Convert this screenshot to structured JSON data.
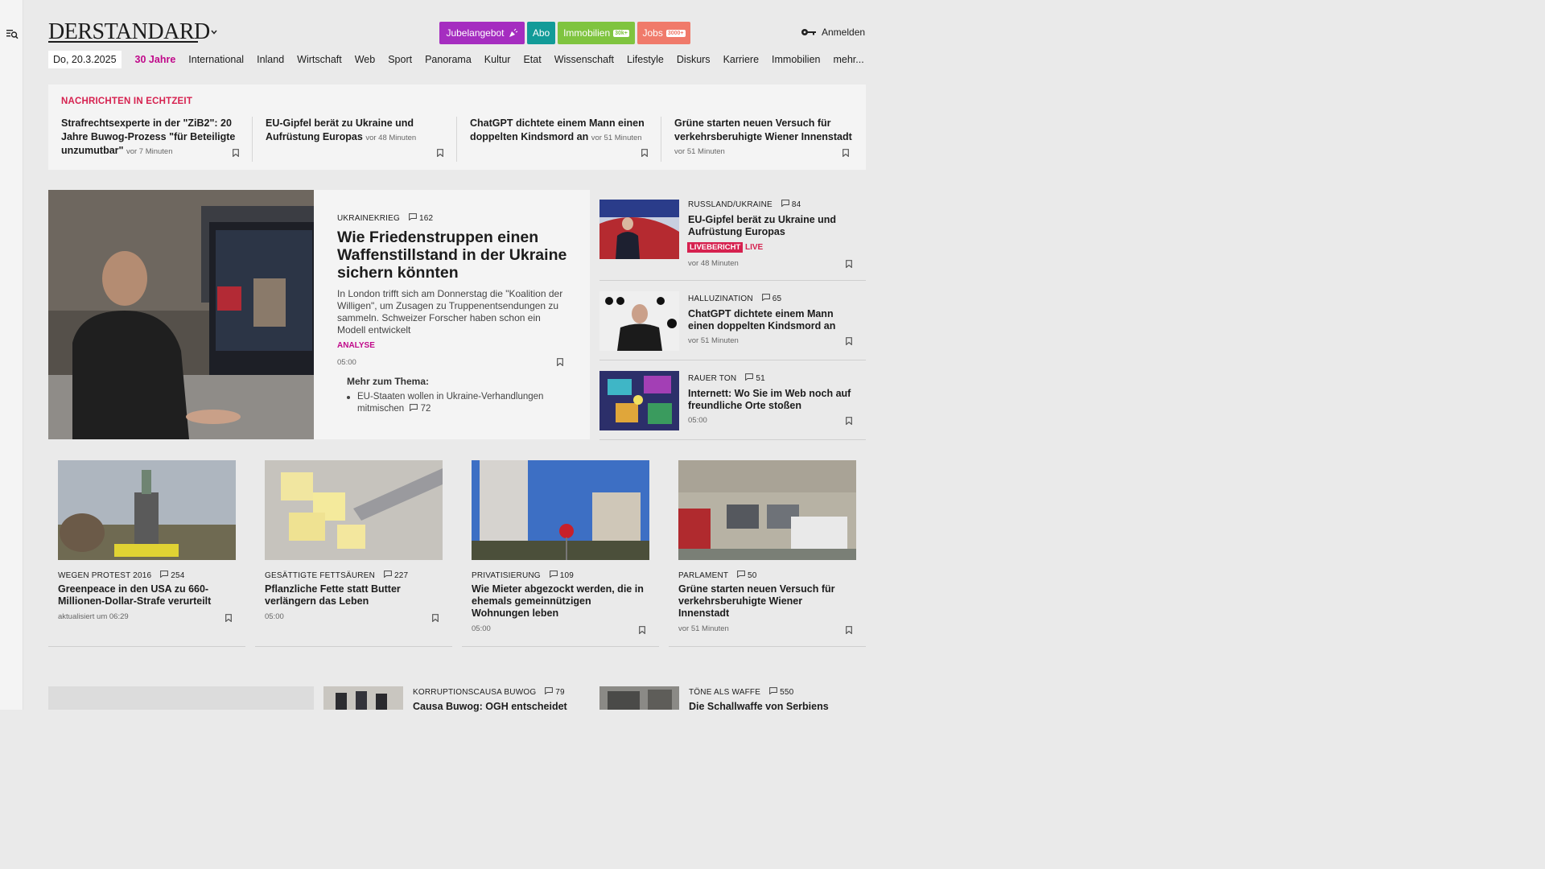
{
  "colors": {
    "magenta": "#c0098a",
    "red": "#d6214f",
    "teal": "#129b98",
    "green": "#7fc43f",
    "salmon": "#f07a6a"
  },
  "logo": {
    "text": "DERSTANDARD"
  },
  "promos": [
    {
      "label": "Jubelangebot",
      "color": "#a52dc0",
      "icon": "confetti-icon"
    },
    {
      "label": "Abo",
      "color": "#129b98"
    },
    {
      "label": "Immobilien",
      "badge": "30k+",
      "color": "#7fc43f"
    },
    {
      "label": "Jobs",
      "badge": "3000+",
      "color": "#f07a6a"
    }
  ],
  "login": {
    "label": "Anmelden",
    "icon": "key-icon"
  },
  "nav": {
    "date": "Do, 20.3.2025",
    "items": [
      "30 Jahre",
      "International",
      "Inland",
      "Wirtschaft",
      "Web",
      "Sport",
      "Panorama",
      "Kultur",
      "Etat",
      "Wissenschaft",
      "Lifestyle",
      "Diskurs",
      "Karriere",
      "Immobilien",
      "mehr..."
    ]
  },
  "ticker": {
    "heading": "NACHRICHTEN IN ECHTZEIT",
    "items": [
      {
        "title": "Strafrechtsexperte in der \"ZiB2\": 20 Jahre Buwog-Prozess \"für Beteiligte unzumutbar\"",
        "time": "vor 7 Minuten"
      },
      {
        "title": "EU-Gipfel berät zu Ukraine und Aufrüstung Europas",
        "time": "vor 48 Minuten"
      },
      {
        "title": "ChatGPT dichtete einem Mann einen doppelten Kindsmord an",
        "time": "vor 51 Minuten"
      },
      {
        "title": "Grüne starten neuen Versuch für verkehrsberuhigte Wiener Innenstadt",
        "time": "vor 51 Minuten"
      }
    ]
  },
  "lead": {
    "kicker": "UKRAINEKRIEG",
    "comments": "162",
    "title": "Wie Friedenstruppen einen Waffenstillstand in der Ukraine sichern könnten",
    "teaser": "In London trifft sich am Donnerstag die \"Koalition der Willigen\", um Zusagen zu Truppenentsendungen zu sammeln. Schweizer Forscher haben schon ein Modell entwickelt",
    "label": "ANALYSE",
    "time": "05:00",
    "more_title": "Mehr zum Thema:",
    "more_item": "EU-Staaten wollen in Ukraine-Verhandlungen mitmischen",
    "more_comments": "72"
  },
  "side": [
    {
      "kicker": "RUSSLAND/UKRAINE",
      "comments": "84",
      "title": "EU-Gipfel berät zu Ukraine und Aufrüstung Europas",
      "badge": "LIVEBERICHT",
      "live": "LIVE",
      "time": "vor 48 Minuten"
    },
    {
      "kicker": "HALLUZINATION",
      "comments": "65",
      "title": "ChatGPT dichtete einem Mann einen doppelten Kindsmord an",
      "time": "vor 51 Minuten"
    },
    {
      "kicker": "RAUER TON",
      "comments": "51",
      "title": "Internett: Wo Sie im Web noch auf freundliche Orte stoßen",
      "time": "05:00"
    }
  ],
  "cards": [
    {
      "kicker": "WEGEN PROTEST 2016",
      "comments": "254",
      "title": "Greenpeace in den USA zu 660-Millionen-Dollar-Strafe verurteilt",
      "time": "aktualisiert um 06:29"
    },
    {
      "kicker": "GESÄTTIGTE FETTSÄUREN",
      "comments": "227",
      "title": "Pflanzliche Fette statt Butter verlängern das Leben",
      "time": "05:00"
    },
    {
      "kicker": "PRIVATISIERUNG",
      "comments": "109",
      "title": "Wie Mieter abgezockt werden, die in ehemals gemeinnützigen Wohnungen leben",
      "time": "05:00"
    },
    {
      "kicker": "PARLAMENT",
      "comments": "50",
      "title": "Grüne starten neuen Versuch für verkehrsberuhigte Wiener Innenstadt",
      "time": "vor 51 Minuten"
    }
  ],
  "bottom": [
    {
      "kicker": "KORRUPTIONSCAUSA BUWOG",
      "comments": "79",
      "title": "Causa Buwog: OGH entscheidet"
    },
    {
      "kicker": "TÖNE ALS WAFFE",
      "comments": "550",
      "title": "Die Schallwaffe von Serbiens"
    }
  ]
}
